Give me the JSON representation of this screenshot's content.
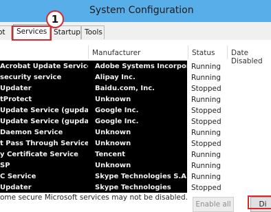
{
  "window": {
    "title": "System Configuration"
  },
  "tabs": [
    {
      "label": "ot",
      "selected": false
    },
    {
      "label": "Services",
      "selected": true
    },
    {
      "label": "Startup",
      "selected": false
    },
    {
      "label": "Tools",
      "selected": false
    }
  ],
  "callout": {
    "number": "1"
  },
  "columns": {
    "manufacturer": "Manufacturer",
    "status": "Status",
    "date_disabled": "Date Disabled"
  },
  "rows": [
    {
      "service": "Acrobat Update Service",
      "manufacturer": "Adobe Systems Incorporated",
      "status": "Running"
    },
    {
      "service": "security service",
      "manufacturer": "Alipay Inc.",
      "status": "Running"
    },
    {
      "service": "Updater",
      "manufacturer": "Baidu.com, Inc.",
      "status": "Stopped"
    },
    {
      "service": "tProtect",
      "manufacturer": "Unknown",
      "status": "Running"
    },
    {
      "service": "Update Service (gupdate)",
      "manufacturer": "Google Inc.",
      "status": "Stopped"
    },
    {
      "service": "Update Service (gupdatem)",
      "manufacturer": "Google Inc.",
      "status": "Stopped"
    },
    {
      "service": "Daemon Service",
      "manufacturer": "Unknown",
      "status": "Running"
    },
    {
      "service": "t Pass Through Service",
      "manufacturer": "Unknown",
      "status": "Stopped"
    },
    {
      "service": "y Certificate Service",
      "manufacturer": "Tencent",
      "status": "Running"
    },
    {
      "service": "SP",
      "manufacturer": "Unknown",
      "status": "Running"
    },
    {
      "service": "C Service",
      "manufacturer": "Skype Technologies S.A.",
      "status": "Running"
    },
    {
      "service": "Updater",
      "manufacturer": "Skype Technologies",
      "status": "Stopped"
    }
  ],
  "footer": {
    "note": "ome secure Microsoft services may not be disabled.",
    "enable_all": "Enable all",
    "disable_all": "Di"
  }
}
